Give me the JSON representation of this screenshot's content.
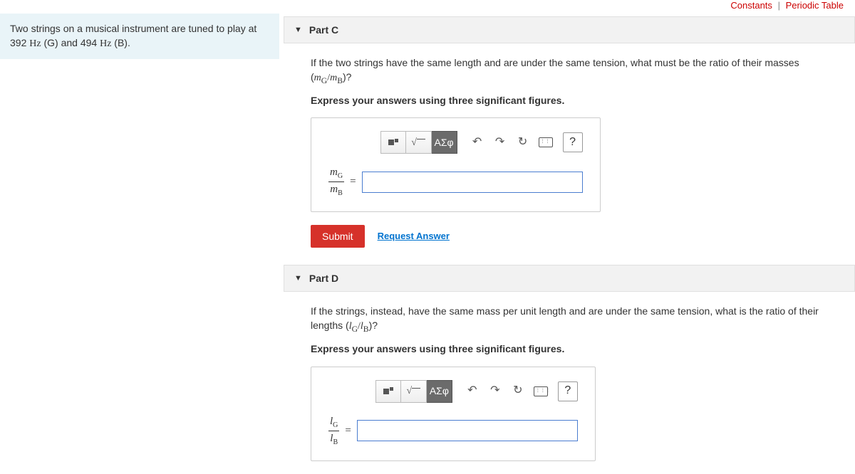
{
  "topLinks": {
    "constants": "Constants",
    "periodic": "Periodic Table"
  },
  "problem": {
    "text_a": "Two strings on a musical instrument are tuned to play at 392 ",
    "hz1": "Hz",
    "text_b": " (G) and 494 ",
    "hz2": "Hz",
    "text_c": " (B)."
  },
  "partC": {
    "title": "Part C",
    "question_a": "If the two strings have the same length and are under the same tension, what must be the ratio of their masses (",
    "ratio_num": "m",
    "ratio_numsub": "G",
    "slash": "/",
    "ratio_den": "m",
    "ratio_densub": "B",
    "question_b": ")?",
    "instruction": "Express your answers using three significant figures.",
    "toolbar": {
      "greek": "ΑΣφ",
      "help": "?"
    },
    "frac": {
      "num": "m",
      "numsub": "G",
      "den": "m",
      "densub": "B"
    },
    "eq": "=",
    "submit": "Submit",
    "request": "Request Answer"
  },
  "partD": {
    "title": "Part D",
    "question_a": "If the strings, instead, have the same mass per unit length and are under the same tension, what is the ratio of their lengths (",
    "ratio_num": "l",
    "ratio_numsub": "G",
    "slash": "/",
    "ratio_den": "l",
    "ratio_densub": "B",
    "question_b": ")?",
    "instruction": "Express your answers using three significant figures.",
    "toolbar": {
      "greek": "ΑΣφ",
      "help": "?"
    },
    "frac": {
      "num": "l",
      "numsub": "G",
      "den": "l",
      "densub": "B"
    },
    "eq": "="
  }
}
